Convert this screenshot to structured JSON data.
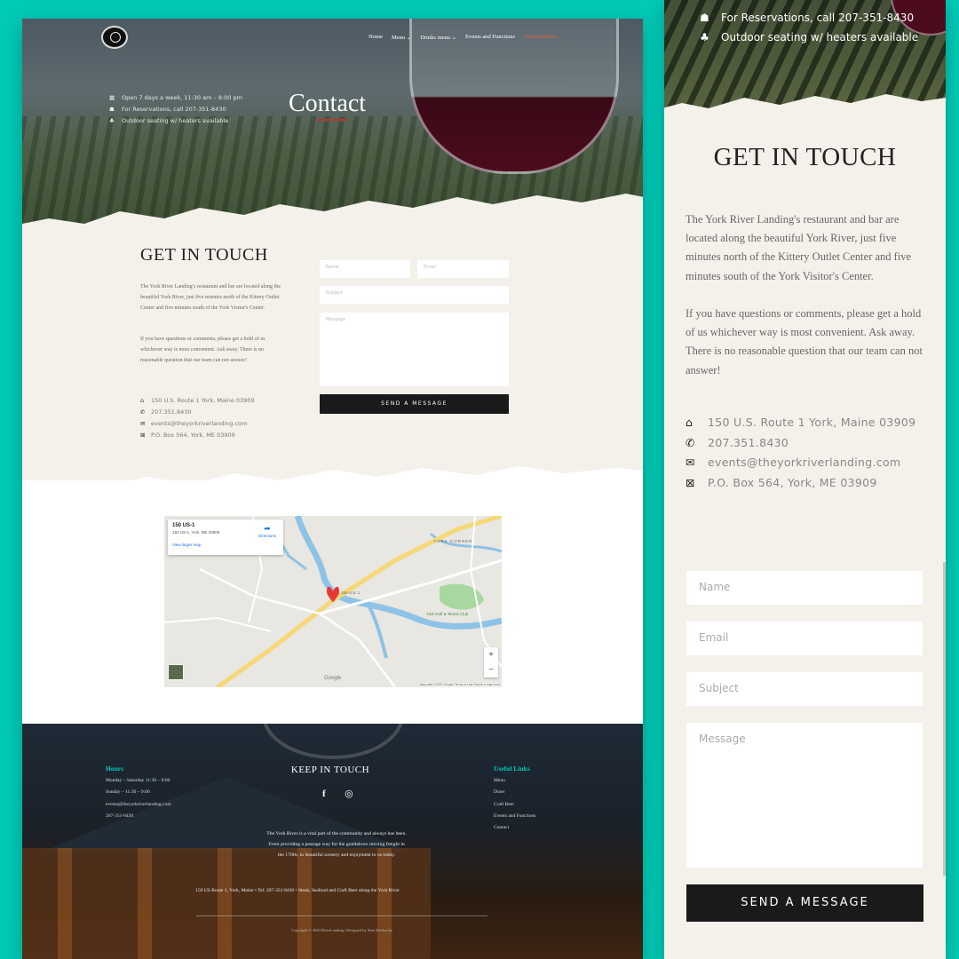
{
  "colors": {
    "teal_background": "#00c9b5",
    "accent_orange": "#e8643a",
    "accent_red": "#b23a2c",
    "button_dark": "#1a1a1a"
  },
  "desktop": {
    "nav": {
      "items": [
        "Home",
        "Menu ⌄",
        "Drinks menu ⌄",
        "Events and Functions",
        "Contact/Hours"
      ],
      "active_index": 4
    },
    "hero": {
      "title": "Contact",
      "info": [
        {
          "icon": "calendar-icon",
          "text": "Open 7 days a week, 11:30 am – 9:00 pm"
        },
        {
          "icon": "reservation-icon",
          "text": "For Reservations, call 207-351-8430"
        },
        {
          "icon": "tree-icon",
          "text": "Outdoor seating w/ heaters available"
        }
      ]
    },
    "get_in_touch": {
      "title": "GET IN TOUCH",
      "p1": "The York River Landing's restaurant and bar are located along the beautiful York River, just five minutes north of the Kittery Outlet Center and five minutes south of the York Visitor's Center.",
      "p2": "If you have questions or comments, please get a hold of us whichever way is most convenient. Ask away. There is no reasonable question that our team can not answer!",
      "contacts": [
        {
          "icon": "home-icon",
          "text": "150 U.S. Route 1 York, Maine 03909"
        },
        {
          "icon": "phone-icon",
          "text": "207.351.8430"
        },
        {
          "icon": "envelope-icon",
          "text": "events@theyorkriverlanding.com"
        },
        {
          "icon": "mailbox-icon",
          "text": "P.O. Box 564, York, ME 03909"
        }
      ]
    },
    "form": {
      "name_placeholder": "Name",
      "email_placeholder": "Email",
      "subject_placeholder": "Subject",
      "message_placeholder": "Message",
      "send_label": "SEND A MESSAGE"
    },
    "map": {
      "place_title": "150 US-1",
      "place_address": "150 US-1, York, ME 03909",
      "larger_map": "View larger map",
      "directions": "Directions",
      "pin_label": "150 U.S. 1",
      "label_york_corner": "YORK CORNER",
      "label_golf": "York Golf & Tennis Club",
      "brand": "Google",
      "footer": "Map data ©2020 Google   Terms of Use   Report a map error",
      "zoom_in": "+",
      "zoom_out": "−"
    },
    "footer": {
      "hours_heading": "Hours",
      "hours": [
        "Monday – Saturday 11:30 – 9:00",
        "Sunday – 11:30 – 9:00",
        "events@theyorkriverlanding.com",
        "207-351-8430"
      ],
      "keep_in_touch": "KEEP IN TOUCH",
      "social": [
        "facebook-icon",
        "instagram-icon"
      ],
      "about": "The York River is a vital part of the community and always has been. From providing a passage way for the gundalows moving freight in the 1700s, to beautiful scenery and enjoyment to us today.",
      "links_heading": "Useful Links",
      "links": [
        "Menu",
        "Diner",
        "Craft Beer",
        "Events and Functions",
        "Contact"
      ],
      "address_line": "150 US Route 1, York, Maine • Tel: 207-351-8430 • Steak, Seafood and Craft Beer along the York River",
      "copyright": "Copyright © 2020 RiverLanding | Designed by Stan Moskovitz"
    }
  },
  "mobile": {
    "hero_info": [
      {
        "icon": "reservation-icon",
        "text": "For Reservations, call 207-351-8430"
      },
      {
        "icon": "tree-icon",
        "text": "Outdoor seating w/ heaters available"
      }
    ],
    "title": "GET IN TOUCH",
    "p1": "The York River Landing's restaurant and bar are located along the beautiful York River, just five minutes north of the Kittery Outlet Center and five minutes south of the York Visitor's Center.",
    "p2": "If you have questions or comments, please get a hold of us whichever way is most convenient. Ask away. There is no reasonable question that our team can not answer!",
    "contacts": [
      {
        "icon": "home-icon",
        "text": "150 U.S. Route 1 York, Maine 03909"
      },
      {
        "icon": "phone-icon",
        "text": "207.351.8430"
      },
      {
        "icon": "envelope-icon",
        "text": "events@theyorkriverlanding.com"
      },
      {
        "icon": "mailbox-icon",
        "text": "P.O. Box 564, York, ME 03909"
      }
    ],
    "form": {
      "name_placeholder": "Name",
      "email_placeholder": "Email",
      "subject_placeholder": "Subject",
      "message_placeholder": "Message",
      "send_label": "SEND A MESSAGE"
    }
  }
}
